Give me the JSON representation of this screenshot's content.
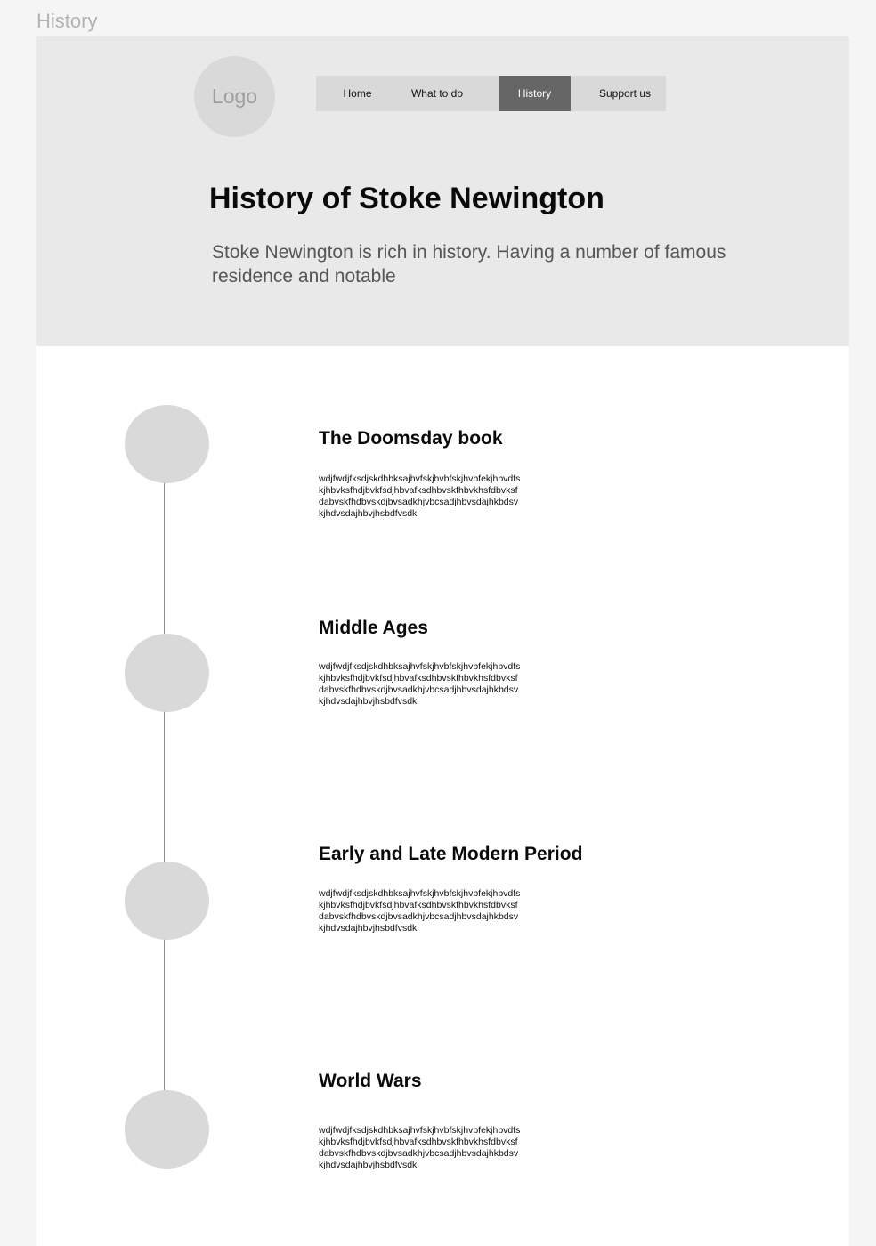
{
  "frame_label": "History",
  "header": {
    "logo": "Logo",
    "nav": [
      {
        "label": "Home"
      },
      {
        "label": "What to do"
      },
      {
        "label": "History"
      },
      {
        "label": "Support us"
      }
    ],
    "active_nav": "History",
    "title": "History of Stoke Newington",
    "intro": "Stoke Newington is rich in history. Having a number of famous residence and notable"
  },
  "timeline": [
    {
      "title": "The Doomsday book",
      "body": "wdjfwdjfksdjskdhbksajhvfskjhvbfskjhvbfekjhbvdfs\nkjhbvksfhdjbvkfsdjhbvafksdhbvskfhbvkhsfdbvksf\ndabvskfhdbvskdjbvsadkhjvbcsadjhbvsdajhkbdsv\nkjhdvsdajhbvjhsbdfvsdk"
    },
    {
      "title": "Middle Ages",
      "body": "wdjfwdjfksdjskdhbksajhvfskjhvbfskjhvbfekjhbvdfs\nkjhbvksfhdjbvkfsdjhbvafksdhbvskfhbvkhsfdbvksf\ndabvskfhdbvskdjbvsadkhjvbcsadjhbvsdajhkbdsv\nkjhdvsdajhbvjhsbdfvsdk"
    },
    {
      "title": "Early and Late Modern Period",
      "body": "wdjfwdjfksdjskdhbksajhvfskjhvbfskjhvbfekjhbvdfs\nkjhbvksfhdjbvkfsdjhbvafksdhbvskfhbvkhsfdbvksf\ndabvskfhdbvskdjbvsadkhjvbcsadjhbvsdajhkbdsv\nkjhdvsdajhbvjhsbdfvsdk"
    },
    {
      "title": "World Wars",
      "body": "wdjfwdjfksdjskdhbksajhvfskjhvbfskjhvbfekjhbvdfs\nkjhbvksfhdjbvkfsdjhbvafksdhbvskfhbvkhsfdbvksf\ndabvskfhdbvskdjbvsadkhjvbcsadjhbvsdajhkbdsv\nkjhdvsdajhbvjhsbdfvsdk"
    }
  ],
  "colors": {
    "page_background": "#f5f5f5",
    "hero_background": "#e9e9e9",
    "placeholder": "#d9d9d9",
    "nav_active": "#666666"
  }
}
